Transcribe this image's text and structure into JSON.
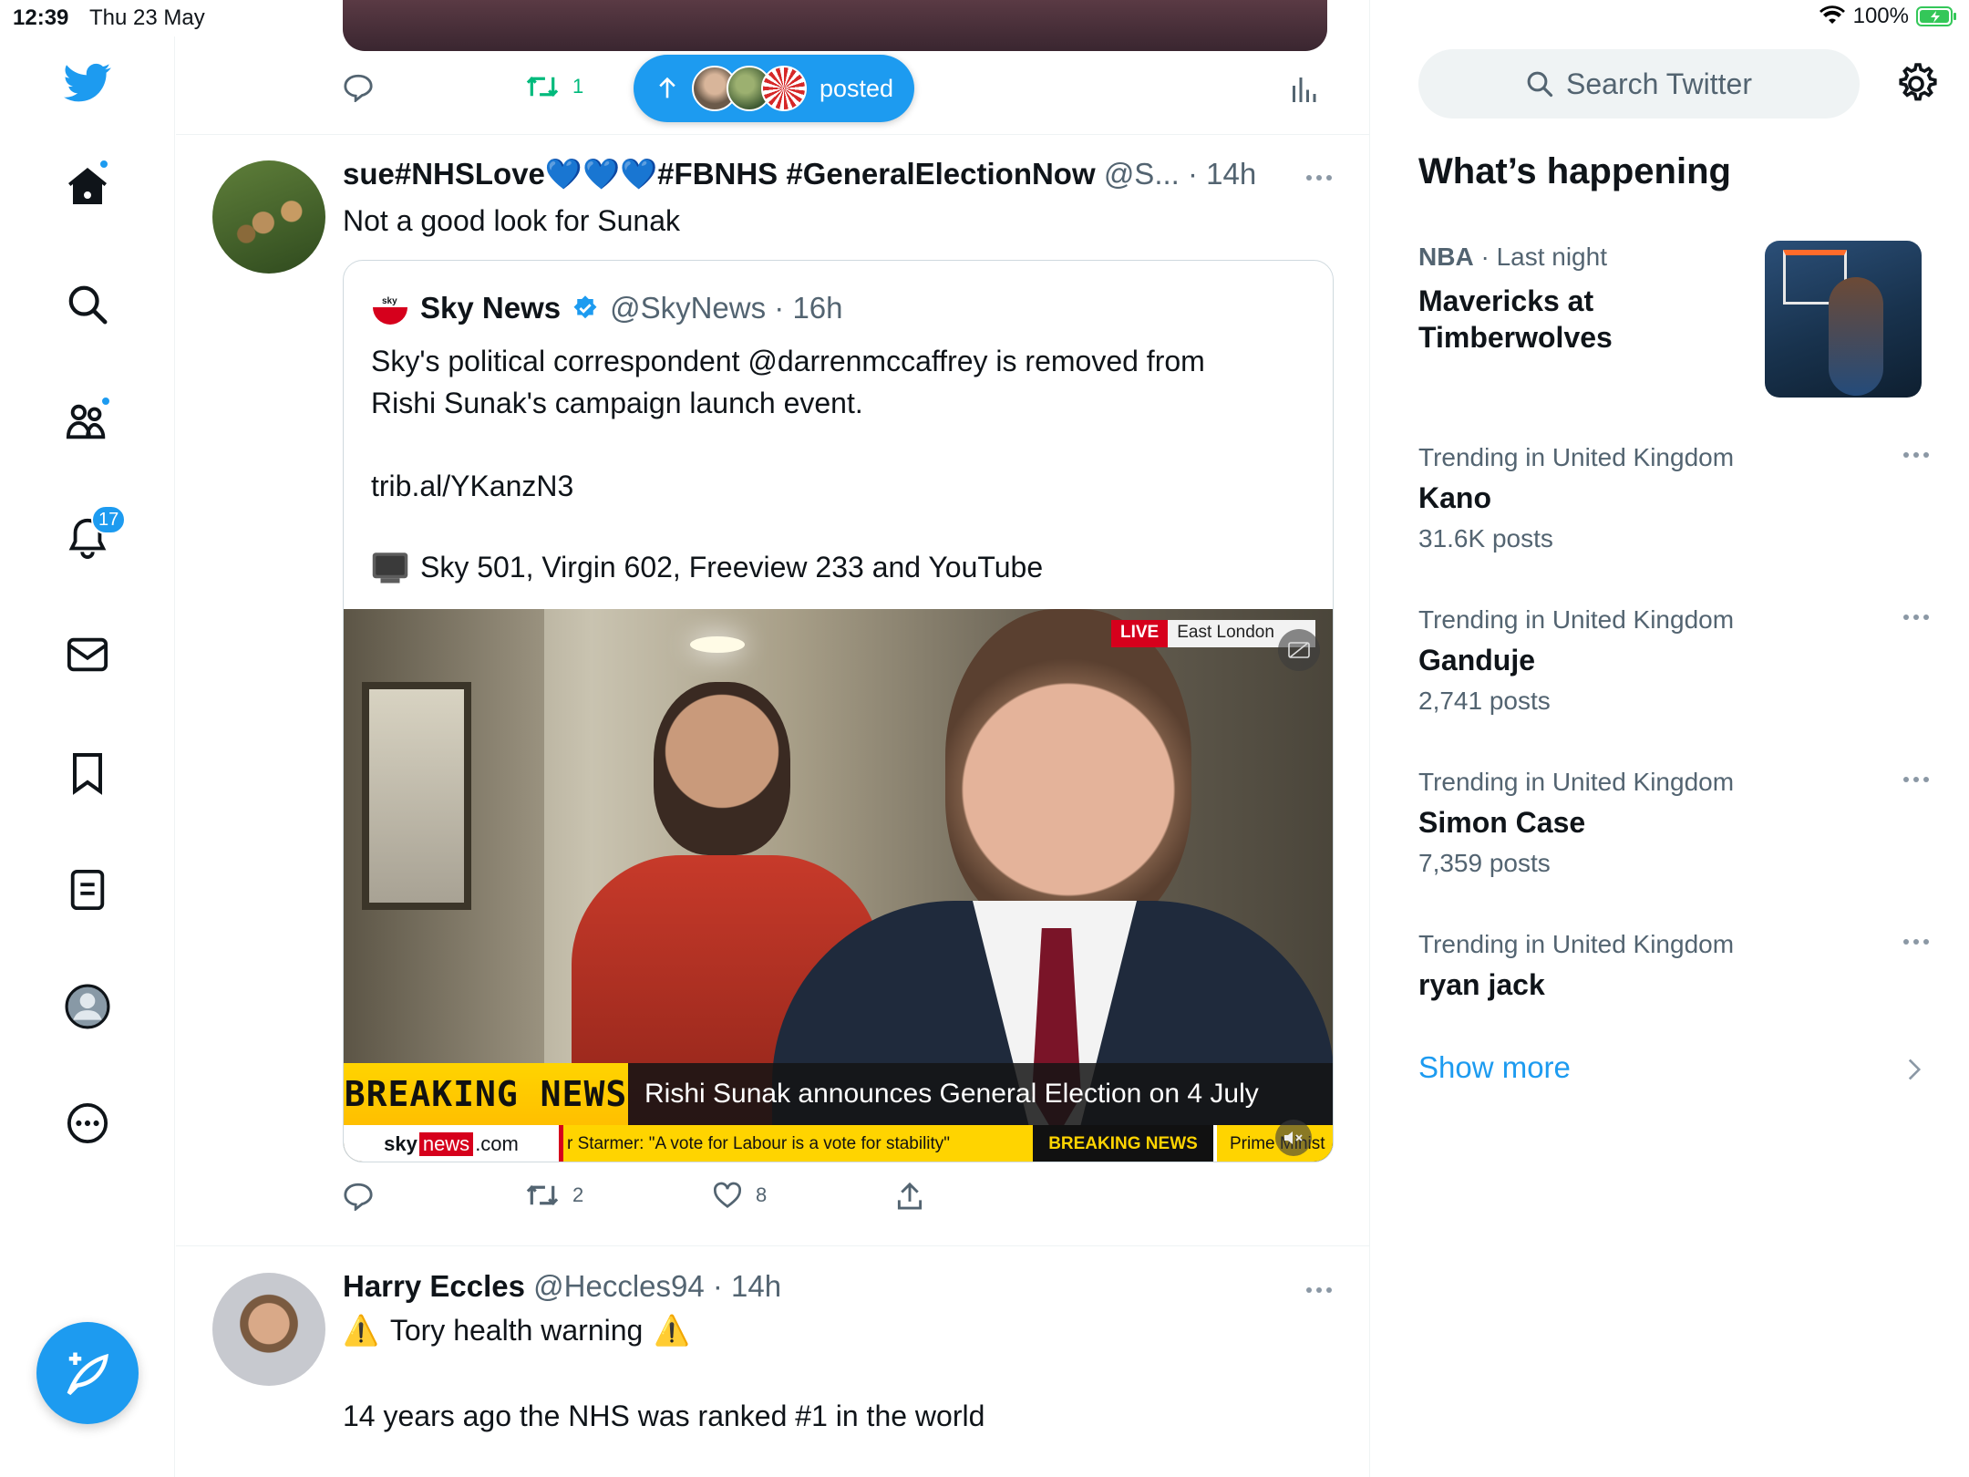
{
  "status_bar": {
    "time": "12:39",
    "date": "Thu 23 May",
    "battery": "100%"
  },
  "main": {
    "prev_tweet_actions": {
      "retweets": "1"
    },
    "posted_pill": {
      "label": "posted"
    },
    "tweets": [
      {
        "author_name": "sue#NHSLove💙💙💙#FBNHS #GeneralElectionNow",
        "handle_time": "@S... · 14h",
        "text": "Not a good look for Sunak",
        "quote": {
          "name": "Sky News",
          "handle_time": "@SkyNews · 16h",
          "lines": [
            "Sky's political correspondent @darrenmccaffrey is removed from",
            "Rishi Sunak's campaign launch event.",
            "trib.al/YKanzN3",
            "Sky 501, Virgin 602, Freeview 233 and YouTube"
          ],
          "video": {
            "live_label": "LIVE",
            "location": "East London",
            "breaking_label": "BREAKING NEWS",
            "headline": "Rishi Sunak announces General Election on 4 July",
            "brand_sky": "sky",
            "brand_news": "news",
            "brand_com": ".com",
            "ticker": "r Starmer: \"A vote for Labour is a vote for stability\"",
            "ticker_breaking": "BREAKING NEWS",
            "ticker_tail": "Prime Minist"
          }
        },
        "actions": {
          "retweets": "2",
          "likes": "8"
        }
      },
      {
        "author_name": "Harry Eccles",
        "handle_time": "@Heccles94 · 14h",
        "line1": "Tory health warning",
        "line2": "14 years ago the NHS was ranked #1 in the world"
      }
    ]
  },
  "sidebar": {
    "search_placeholder": "Search Twitter",
    "whats_happening": "What’s happening",
    "featured": {
      "category": "NBA",
      "time": "Last night",
      "title_line1": "Mavericks at",
      "title_line2": "Timberwolves"
    },
    "trends": [
      {
        "context": "Trending in United Kingdom",
        "title": "Kano",
        "count": "31.6K posts"
      },
      {
        "context": "Trending in United Kingdom",
        "title": "Ganduje",
        "count": "2,741 posts"
      },
      {
        "context": "Trending in United Kingdom",
        "title": "Simon Case",
        "count": "7,359 posts"
      },
      {
        "context": "Trending in United Kingdom",
        "title": "ryan jack",
        "count": ""
      }
    ],
    "show_more": "Show more"
  },
  "nav": {
    "notifications_count": "17"
  },
  "colors": {
    "accent": "#1d9bf0",
    "retweet_green": "#00ba7c",
    "muted": "#536471"
  }
}
